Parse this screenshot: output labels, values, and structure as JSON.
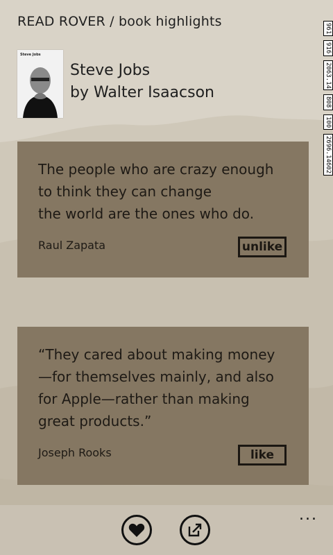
{
  "header": {
    "title": "READ ROVER / book highlights"
  },
  "book": {
    "cover_text": "Steve Jobs",
    "title": "Steve Jobs",
    "author": "by Walter Isaacson"
  },
  "highlights": [
    {
      "quote": "The people who are crazy enough\nto think they can change\nthe world are the ones who do.",
      "author": "Raul Zapata",
      "button": "unlike"
    },
    {
      "quote": "“They cared about making money\n—for themselves mainly, and also\nfor Apple—rather than making\ngreat products.”",
      "author": "Joseph Rooks",
      "button": "like"
    }
  ],
  "appbar": {
    "buttons": [
      {
        "icon": "heart-icon"
      },
      {
        "icon": "share-icon"
      }
    ],
    "more": "..."
  },
  "system_tray": {
    "values": [
      "961",
      "916",
      "2063.14",
      "808",
      "100",
      "2696.14602"
    ]
  },
  "colors": {
    "background": "#d9d3c7",
    "card": "#857762",
    "appbar": "#c9c1b3"
  }
}
